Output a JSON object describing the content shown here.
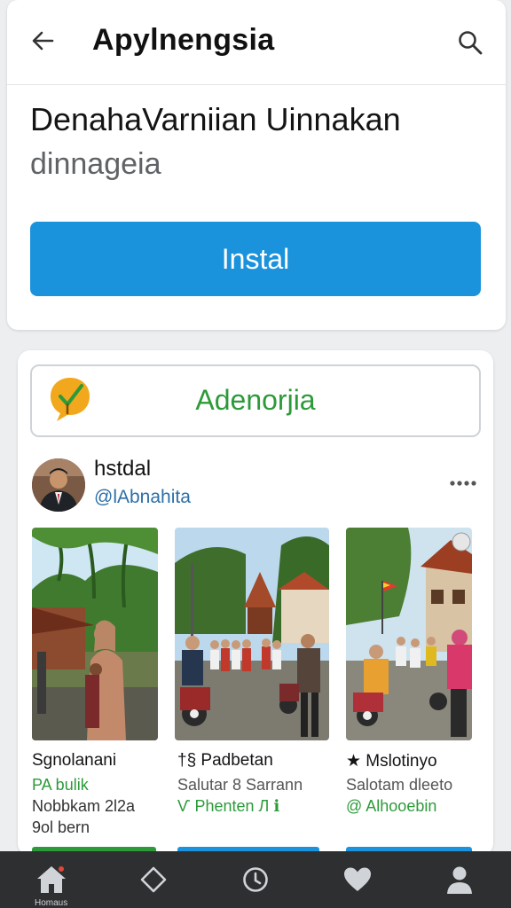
{
  "appbar": {
    "title": "Apylnengsia",
    "icons": [
      "back-arrow-icon",
      "search-icon"
    ]
  },
  "hero": {
    "headline": "DenahaVarniian Uinnakan",
    "subline": "dinnageia",
    "install_label": "Instal",
    "install_color": "#1b93dc"
  },
  "brand": {
    "name": "Adenorjia",
    "logo_icon": "check-bubble-icon",
    "accent": "#2d9a3a"
  },
  "post": {
    "user": "hstdal",
    "handle": "@lAbnahita",
    "more_icon": "more-dots-icon"
  },
  "tiles": [
    {
      "title": "Sgnolanani",
      "sub": "PA bulik",
      "meta": "Nobbkam 2l2a",
      "meta2": "9ol bern"
    },
    {
      "title": "†§ Padbetan",
      "sub": "Salutar 8 Sarrann",
      "meta": "Ѵ Phenten Л ℹ "
    },
    {
      "title": "★ Mslotinyo",
      "sub": "Salotam dleeto",
      "meta": "@ Alhooebin"
    }
  ],
  "nav": {
    "items": [
      {
        "icon": "home-icon",
        "label": "Homaus"
      },
      {
        "icon": "tag-icon",
        "label": ""
      },
      {
        "icon": "clock-icon",
        "label": ""
      },
      {
        "icon": "heart-icon",
        "label": ""
      },
      {
        "icon": "profile-icon",
        "label": ""
      }
    ]
  }
}
